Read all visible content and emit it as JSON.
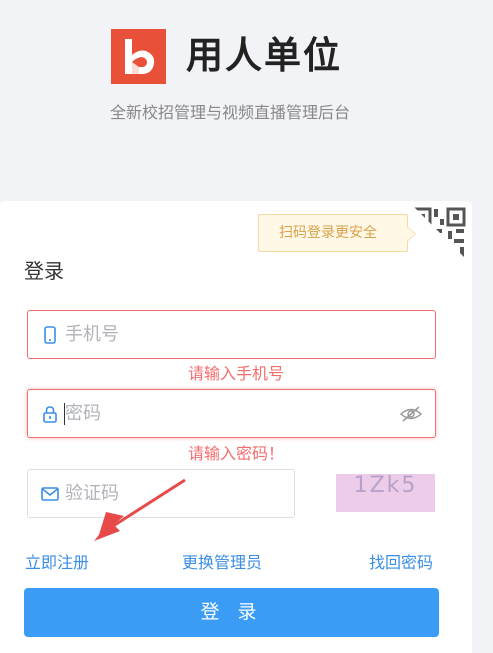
{
  "brand": {
    "title": "用人单位",
    "subtitle": "全新校招管理与视频直播管理后台",
    "logo_icon": "app-logo-icon",
    "logo_color": "#e8503a"
  },
  "login": {
    "qr_tip": "扫码登录更安全",
    "title": "登录",
    "phone_placeholder": "手机号",
    "phone_error": "请输入手机号",
    "password_placeholder": "密码",
    "password_error": "请输入密码！",
    "code_placeholder": "验证码",
    "captcha_text": "1Zk5",
    "register_link": "立即注册",
    "switch_admin_link": "更换管理员",
    "forgot_link": "找回密码",
    "submit_label": "登 录"
  },
  "colors": {
    "primary": "#3a9cf5",
    "error": "#f56c6c",
    "link": "#3a8ee6",
    "tip_text": "#d9a14a",
    "annotation_arrow": "#e84a4a"
  }
}
